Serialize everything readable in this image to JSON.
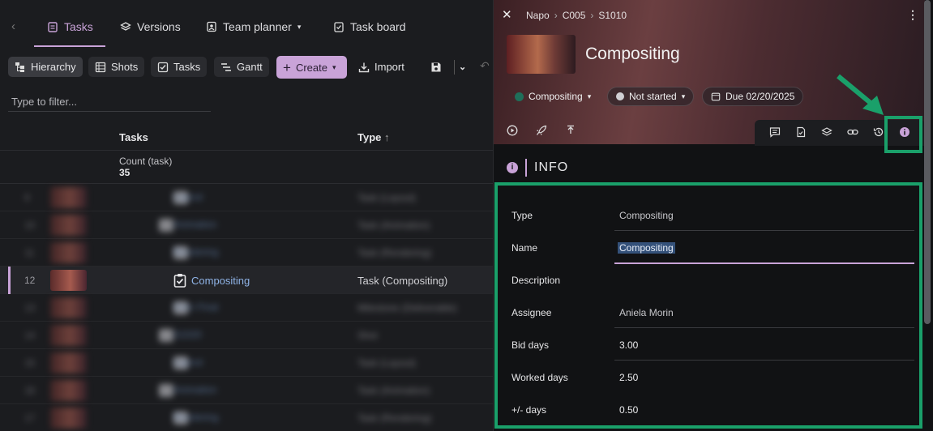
{
  "tabs": [
    {
      "label": "Tasks",
      "active": true
    },
    {
      "label": "Versions",
      "active": false
    },
    {
      "label": "Team planner",
      "active": false
    },
    {
      "label": "Task board",
      "active": false
    }
  ],
  "toolbar": {
    "hierarchy": "Hierarchy",
    "shots": "Shots",
    "tasks": "Tasks",
    "gantt": "Gantt",
    "create": "Create",
    "import": "Import"
  },
  "filter": {
    "placeholder": "Type to filter..."
  },
  "table": {
    "col_tasks": "Tasks",
    "col_type": "Type",
    "count_label": "Count (task)",
    "count_value": "35",
    "rows": [
      {
        "num": "9",
        "task": "Layout",
        "type": "Task (Layout)",
        "blurred": true
      },
      {
        "num": "10",
        "task": "Animation",
        "type": "Task (Animation)",
        "blurred": true
      },
      {
        "num": "11",
        "task": "Rendering",
        "type": "Task (Rendering)",
        "blurred": true
      },
      {
        "num": "12",
        "task": "Compositing",
        "type": "Task (Compositing)",
        "blurred": false
      },
      {
        "num": "13",
        "task": "Grim Final",
        "type": "Milestone (Deliverable)",
        "blurred": true
      },
      {
        "num": "14",
        "task": "S1020",
        "type": "Shot",
        "blurred": true
      },
      {
        "num": "15",
        "task": "Layout",
        "type": "Task (Layout)",
        "blurred": true
      },
      {
        "num": "16",
        "task": "Animation",
        "type": "Task (Animation)",
        "blurred": true
      },
      {
        "num": "17",
        "task": "Rendering",
        "type": "Task (Rendering)",
        "blurred": true
      }
    ]
  },
  "panel": {
    "breadcrumb": [
      "Napo",
      "C005",
      "S1010"
    ],
    "title": "Compositing",
    "type_pill": "Compositing",
    "status_pill": "Not started",
    "due_pill": "Due 02/20/2025",
    "section_title": "INFO",
    "fields": [
      {
        "label": "Type",
        "value": "Compositing"
      },
      {
        "label": "Name",
        "value": "Compositing"
      },
      {
        "label": "Description",
        "value": ""
      },
      {
        "label": "Assignee",
        "value": "Aniela Morin"
      },
      {
        "label": "Bid days",
        "value": "3.00"
      },
      {
        "label": "Worked days",
        "value": "2.50"
      },
      {
        "label": "+/- days",
        "value": "0.50"
      }
    ]
  },
  "colors": {
    "accent": "#c9a3d8",
    "highlight": "#1aa06a",
    "background": "#1b1c1f"
  }
}
